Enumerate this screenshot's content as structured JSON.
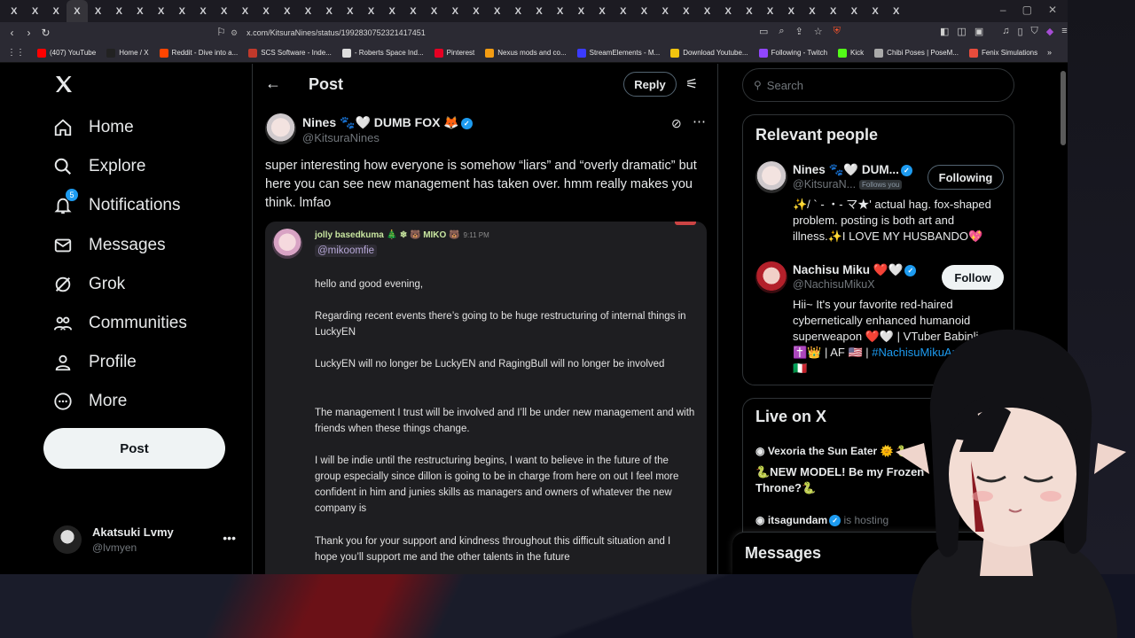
{
  "browser": {
    "tab_count": 43,
    "tab_glyph": "X",
    "url": "x.com/KitsuraNines/status/1992830752321417451",
    "bookmarks": [
      {
        "label": "(407) YouTube",
        "color": "#ff0000"
      },
      {
        "label": "Home / X",
        "color": "#222222"
      },
      {
        "label": "Reddit - Dive into a...",
        "color": "#ff4500"
      },
      {
        "label": "SCS Software - Inde...",
        "color": "#c0392b"
      },
      {
        "label": "- Roberts Space Ind...",
        "color": "#dddddd"
      },
      {
        "label": "Pinterest",
        "color": "#e60023"
      },
      {
        "label": "Nexus mods and co...",
        "color": "#f39c12"
      },
      {
        "label": "StreamElements - M...",
        "color": "#3b3bff"
      },
      {
        "label": "Download Youtube...",
        "color": "#f1c40f"
      },
      {
        "label": "Following - Twitch",
        "color": "#9146ff"
      },
      {
        "label": "Kick",
        "color": "#53fc18"
      },
      {
        "label": "Chibi Poses | PoseM...",
        "color": "#aaaaaa"
      },
      {
        "label": "Fenix Simulations",
        "color": "#e74c3c"
      }
    ]
  },
  "nav": {
    "items": [
      {
        "label": "Home",
        "icon": "home-icon"
      },
      {
        "label": "Explore",
        "icon": "search-icon"
      },
      {
        "label": "Notifications",
        "icon": "bell-icon"
      },
      {
        "label": "Messages",
        "icon": "mail-icon"
      },
      {
        "label": "Grok",
        "icon": "grok-icon"
      },
      {
        "label": "Communities",
        "icon": "people-icon"
      },
      {
        "label": "Profile",
        "icon": "person-icon"
      },
      {
        "label": "More",
        "icon": "more-circle-icon"
      }
    ],
    "notif_count": "5",
    "post_label": "Post",
    "account_name": "Akatsuki Lvmy",
    "account_handle": "@lvmyen"
  },
  "main": {
    "title": "Post",
    "reply_label": "Reply",
    "author_name": "Nines 🐾🤍 DUMB FOX 🦊",
    "author_handle": "@KitsuraNines",
    "text": "super interesting how everyone is somehow “liars” and “overly dramatic” but here you can see new management has taken over. hmm really makes you think. lmfao",
    "quote": {
      "name": "jolly basedkuma 🎄 ❄ 🐻 MIKO 🐻",
      "time": "9:11 PM",
      "handle": "@mikoomfie",
      "paragraphs": [
        "hello and good evening,",
        "Regarding recent events there’s going to be huge restructuring of internal things in LuckyEN",
        "LuckyEN will no longer be LuckyEN and RagingBull will no longer be involved",
        "The management I trust will be involved and I’ll be under new management and with friends when these things change.",
        "I will be indie until the restructuring begins, I want to believe in the future of the group especially since dillon is going to be in charge from here on out I feel more confident in him and junies skills as managers and owners of whatever the new company is",
        "Thank you for your support and kindness throughout this difficult situation and I hope you’ll support me and the other talents in the future"
      ]
    }
  },
  "right": {
    "search_placeholder": "Search",
    "relevant_title": "Relevant people",
    "people": [
      {
        "name": "Nines 🐾🤍 DUM...",
        "handle": "@KitsuraN...",
        "follows_you": "Follows you",
        "button": "Following",
        "bio": "✨/ ` - ・- マ★' actual hag. fox-shaped problem. posting is both art and illness.✨I LOVE MY HUSBANDO💖"
      },
      {
        "name": "Nachisu Miku ❤️🤍",
        "handle": "@NachisuMikuX",
        "button": "Follow",
        "bio_1": "Hii~ It's your favorite red-haired cybernetically enhanced humanoid superweapon ❤️🤍 | VTuber Babinli ✝️👑 | AF 🇺🇸 | ",
        "bio_link": "#NachisuMikuArt",
        "bio_2": " 🇩🇪🇫🇷🇮🇹"
      }
    ],
    "live_title": "Live on X",
    "live_1_name": "Vexoria the Sun Eater 🌞 🐍",
    "live_1_desc": "🐍NEW MODEL! Be my Frozen Throne?🐍",
    "live_2_name": "itsagundam",
    "live_2_status": "is hosting",
    "messages_label": "Messages"
  }
}
